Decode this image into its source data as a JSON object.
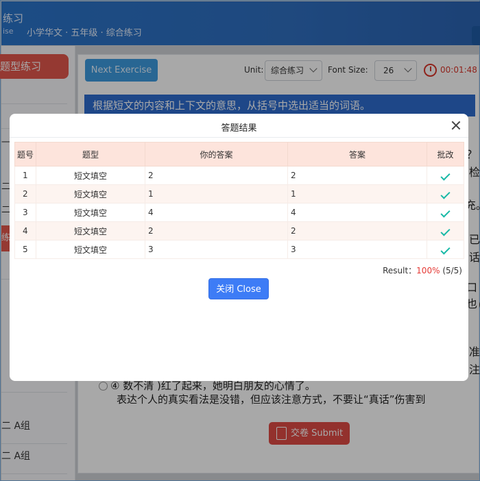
{
  "header": {
    "title_fragment": "练习",
    "subtitle_fragment": "ise",
    "breadcrumb": "小学华文 · 五年级 · 综合练习"
  },
  "sidebar": {
    "active_tab": "题型练习",
    "marks": [
      "二",
      "二"
    ],
    "red_mark": "练",
    "items": [
      "二 A组",
      "二 A组"
    ]
  },
  "toolbar": {
    "next_label": "Next Exercise",
    "unit_label": "Unit:",
    "unit_value": "综合练习",
    "font_size_label": "Font Size:",
    "font_size_value": "26",
    "timer": "00:01:48"
  },
  "question": {
    "instruction": "根据短文的内容和上下文的意思，从括号中选出适当的词语。",
    "right_edge_chars": [
      "？",
      "检",
      "充。",
      "已",
      "话",
      "口也",
      "（",
      "准",
      "注"
    ],
    "option4": "④ 数不清 )红了起来，她明白朋友的心情了。",
    "passage_end": "表达个人的真实看法是没错，但应该注意方式，不要让“真话”伤害到"
  },
  "submit": {
    "label": "交卷 Submit"
  },
  "modal": {
    "title": "答题结果",
    "columns": [
      "题号",
      "题型",
      "你的答案",
      "答案",
      "批改"
    ],
    "rows": [
      {
        "no": "1",
        "type": "短文填空",
        "your_answer": "2",
        "answer": "2",
        "correct": true
      },
      {
        "no": "2",
        "type": "短文填空",
        "your_answer": "1",
        "answer": "1",
        "correct": true
      },
      {
        "no": "3",
        "type": "短文填空",
        "your_answer": "4",
        "answer": "4",
        "correct": true
      },
      {
        "no": "4",
        "type": "短文填空",
        "your_answer": "2",
        "answer": "2",
        "correct": true
      },
      {
        "no": "5",
        "type": "短文填空",
        "your_answer": "3",
        "answer": "3",
        "correct": true
      }
    ],
    "result_label": "Result：",
    "result_percent": "100%",
    "result_count": "(5/5)",
    "close_label": "关闭 Close"
  },
  "colors": {
    "header_blue": "#2a74c9",
    "accent_red": "#e2574c",
    "table_header_bg": "#fde4dc",
    "check_green": "#18b9a6",
    "close_button_blue": "#3d7cf6",
    "percent_red": "#e53935"
  },
  "icons": [
    "close-icon",
    "check-icon",
    "timer-icon",
    "chevron-down-icon",
    "submit-icon"
  ]
}
